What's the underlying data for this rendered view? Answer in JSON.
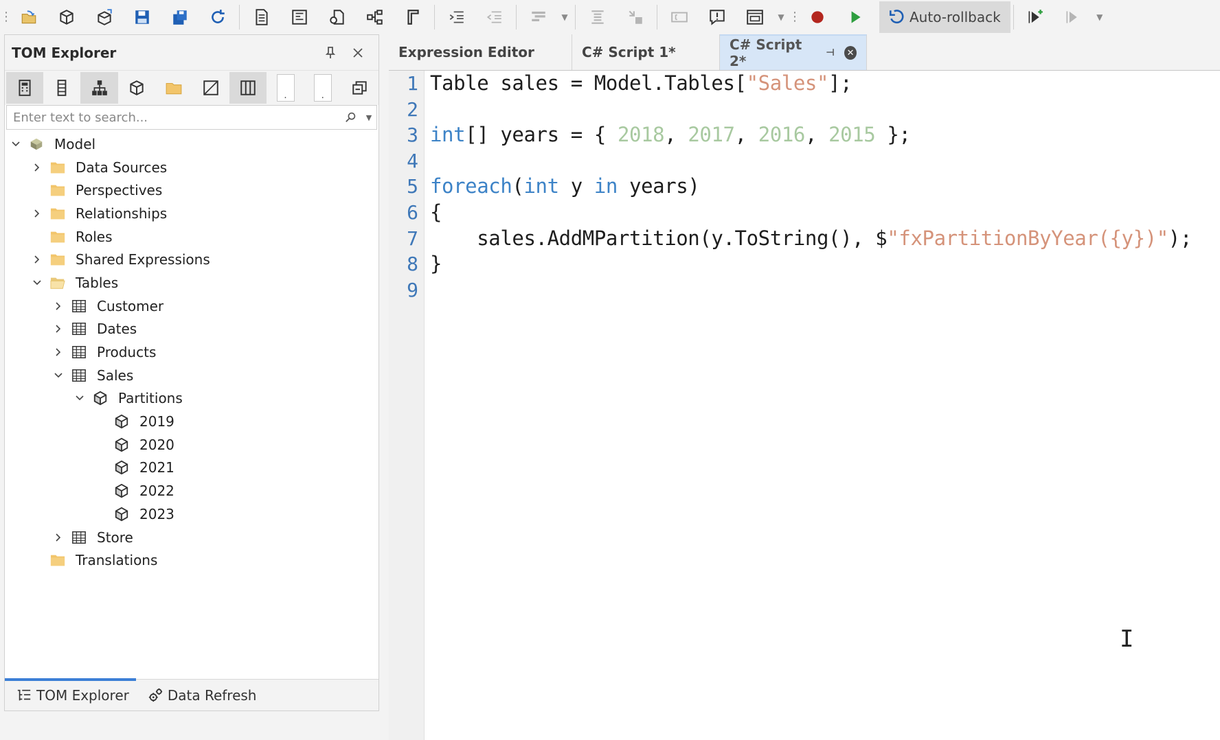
{
  "toolbar": {
    "buttons": [
      "open-icon",
      "deploy-icon",
      "load-icon",
      "save-icon",
      "save-all-icon",
      "refresh-icon",
      "new-doc-icon",
      "expression-icon",
      "query-icon",
      "hierarchy-icon",
      "format-icon",
      "indent-icon",
      "outdent-icon",
      "comment-icon",
      "uncomment-icon",
      "replace-icon",
      "annotation-icon",
      "alert-icon",
      "window-icon"
    ],
    "record_color": "#b3261e",
    "play_color": "#2e9e3f",
    "auto_rollback_label": "Auto-rollback"
  },
  "tom_explorer": {
    "title": "TOM Explorer",
    "search_placeholder": "Enter text to search...",
    "tree": [
      {
        "label": "Model",
        "level": 0,
        "expander": "expanded",
        "icon": "model-icon"
      },
      {
        "label": "Data Sources",
        "level": 1,
        "expander": "collapsed",
        "icon": "folder-icon"
      },
      {
        "label": "Perspectives",
        "level": 1,
        "expander": "none",
        "icon": "folder-icon"
      },
      {
        "label": "Relationships",
        "level": 1,
        "expander": "collapsed",
        "icon": "folder-icon"
      },
      {
        "label": "Roles",
        "level": 1,
        "expander": "none",
        "icon": "folder-icon"
      },
      {
        "label": "Shared Expressions",
        "level": 1,
        "expander": "collapsed",
        "icon": "folder-icon"
      },
      {
        "label": "Tables",
        "level": 1,
        "expander": "expanded",
        "icon": "open-folder-icon"
      },
      {
        "label": "Customer",
        "level": 2,
        "expander": "collapsed",
        "icon": "table-icon"
      },
      {
        "label": "Dates",
        "level": 2,
        "expander": "collapsed",
        "icon": "table-icon"
      },
      {
        "label": "Products",
        "level": 2,
        "expander": "collapsed",
        "icon": "table-icon"
      },
      {
        "label": "Sales",
        "level": 2,
        "expander": "expanded",
        "icon": "table-icon"
      },
      {
        "label": "Partitions",
        "level": 3,
        "expander": "expanded",
        "icon": "partition-icon"
      },
      {
        "label": "2019",
        "level": 4,
        "expander": "none",
        "icon": "partition-icon"
      },
      {
        "label": "2020",
        "level": 4,
        "expander": "none",
        "icon": "partition-icon"
      },
      {
        "label": "2021",
        "level": 4,
        "expander": "none",
        "icon": "partition-icon"
      },
      {
        "label": "2022",
        "level": 4,
        "expander": "none",
        "icon": "partition-icon"
      },
      {
        "label": "2023",
        "level": 4,
        "expander": "none",
        "icon": "partition-icon"
      },
      {
        "label": "Store",
        "level": 2,
        "expander": "collapsed",
        "icon": "table-icon"
      },
      {
        "label": "Translations",
        "level": 1,
        "expander": "none",
        "icon": "folder-icon"
      }
    ],
    "bottom_tabs": [
      {
        "label": "TOM Explorer",
        "active": true
      },
      {
        "label": "Data Refresh",
        "active": false
      }
    ]
  },
  "editor": {
    "tabs": [
      {
        "label": "Expression Editor",
        "active": false
      },
      {
        "label": "C# Script 1*",
        "active": false
      },
      {
        "label": "C# Script 2*",
        "active": true
      }
    ],
    "line_numbers": [
      "1",
      "2",
      "3",
      "4",
      "5",
      "6",
      "7",
      "8",
      "9"
    ],
    "code_lines": [
      [
        {
          "t": "Table sales = Model.Tables[",
          "c": "plain"
        },
        {
          "t": "\"Sales\"",
          "c": "str"
        },
        {
          "t": "];",
          "c": "plain"
        }
      ],
      [],
      [
        {
          "t": "int",
          "c": "kw"
        },
        {
          "t": "[] years = { ",
          "c": "plain"
        },
        {
          "t": "2018",
          "c": "num"
        },
        {
          "t": ", ",
          "c": "plain"
        },
        {
          "t": "2017",
          "c": "num"
        },
        {
          "t": ", ",
          "c": "plain"
        },
        {
          "t": "2016",
          "c": "num"
        },
        {
          "t": ", ",
          "c": "plain"
        },
        {
          "t": "2015",
          "c": "num"
        },
        {
          "t": " };",
          "c": "plain"
        }
      ],
      [],
      [
        {
          "t": "foreach",
          "c": "kw"
        },
        {
          "t": "(",
          "c": "plain"
        },
        {
          "t": "int",
          "c": "kw"
        },
        {
          "t": " y ",
          "c": "plain"
        },
        {
          "t": "in",
          "c": "kw"
        },
        {
          "t": " years)",
          "c": "plain"
        }
      ],
      [
        {
          "t": "{",
          "c": "plain"
        }
      ],
      [
        {
          "t": "    sales.AddMPartition(y.ToString(), $",
          "c": "plain"
        },
        {
          "t": "\"fxPartitionByYear({y})\"",
          "c": "str"
        },
        {
          "t": ");",
          "c": "plain"
        }
      ],
      [
        {
          "t": "}",
          "c": "plain"
        }
      ],
      []
    ]
  }
}
